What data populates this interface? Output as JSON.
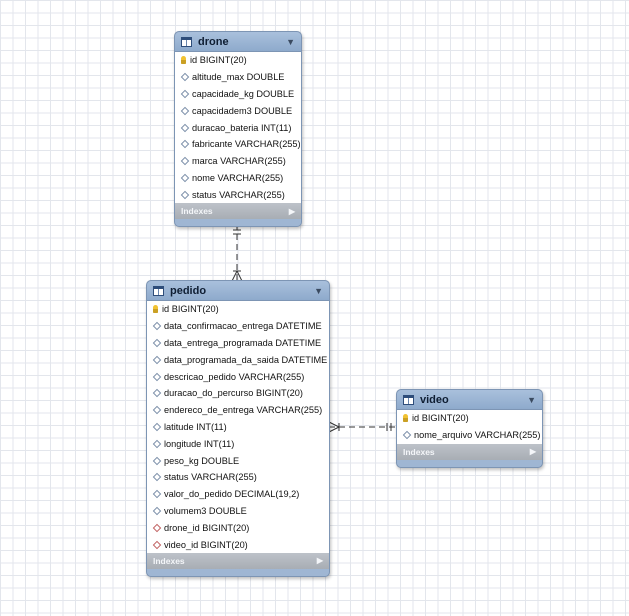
{
  "tables": {
    "drone": {
      "name": "drone",
      "columns": [
        {
          "text": "id BIGINT(20)",
          "kind": "pk"
        },
        {
          "text": "altitude_max DOUBLE",
          "kind": "col"
        },
        {
          "text": "capacidade_kg DOUBLE",
          "kind": "col"
        },
        {
          "text": "capacidadem3 DOUBLE",
          "kind": "col"
        },
        {
          "text": "duracao_bateria INT(11)",
          "kind": "col"
        },
        {
          "text": "fabricante VARCHAR(255)",
          "kind": "col"
        },
        {
          "text": "marca VARCHAR(255)",
          "kind": "col"
        },
        {
          "text": "nome VARCHAR(255)",
          "kind": "col"
        },
        {
          "text": "status VARCHAR(255)",
          "kind": "col"
        }
      ],
      "indexes_label": "Indexes"
    },
    "pedido": {
      "name": "pedido",
      "columns": [
        {
          "text": "id BIGINT(20)",
          "kind": "pk"
        },
        {
          "text": "data_confirmacao_entrega DATETIME",
          "kind": "col"
        },
        {
          "text": "data_entrega_programada DATETIME",
          "kind": "col"
        },
        {
          "text": "data_programada_da_saida DATETIME",
          "kind": "col"
        },
        {
          "text": "descricao_pedido VARCHAR(255)",
          "kind": "col"
        },
        {
          "text": "duracao_do_percurso BIGINT(20)",
          "kind": "col"
        },
        {
          "text": "endereco_de_entrega VARCHAR(255)",
          "kind": "col"
        },
        {
          "text": "latitude INT(11)",
          "kind": "col"
        },
        {
          "text": "longitude INT(11)",
          "kind": "col"
        },
        {
          "text": "peso_kg DOUBLE",
          "kind": "col"
        },
        {
          "text": "status VARCHAR(255)",
          "kind": "col"
        },
        {
          "text": "valor_do_pedido DECIMAL(19,2)",
          "kind": "col"
        },
        {
          "text": "volumem3 DOUBLE",
          "kind": "col"
        },
        {
          "text": "drone_id BIGINT(20)",
          "kind": "fk"
        },
        {
          "text": "video_id BIGINT(20)",
          "kind": "fk"
        }
      ],
      "indexes_label": "Indexes"
    },
    "video": {
      "name": "video",
      "columns": [
        {
          "text": "id BIGINT(20)",
          "kind": "pk"
        },
        {
          "text": "nome_arquivo VARCHAR(255)",
          "kind": "col"
        }
      ],
      "indexes_label": "Indexes"
    }
  },
  "relationships": [
    {
      "from": "pedido",
      "to": "drone",
      "notation": "many-to-one"
    },
    {
      "from": "pedido",
      "to": "video",
      "notation": "many-to-one"
    }
  ],
  "colors": {
    "table_header": "#9fb6d3",
    "indexes_bar": "#b3b8bf",
    "grid": "#e3e6ec",
    "foreign_key_marker": "#c06060",
    "primary_key_marker": "#f1c232"
  }
}
